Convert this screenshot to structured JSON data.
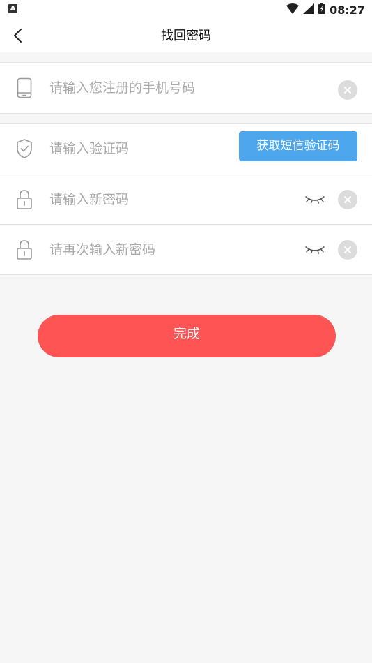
{
  "status_bar": {
    "time": "08:27",
    "left_icon": "A",
    "icons": [
      "wifi-icon",
      "signal-icon",
      "battery-icon"
    ]
  },
  "header": {
    "title": "找回密码",
    "back_icon": "chevron-left-icon"
  },
  "form": {
    "phone": {
      "placeholder": "请输入您注册的手机号码",
      "icon": "phone-icon"
    },
    "code": {
      "placeholder": "请输入验证码",
      "icon": "shield-check-icon",
      "button_label": "获取短信验证码"
    },
    "new_password": {
      "placeholder": "请输入新密码",
      "icon": "lock-icon"
    },
    "confirm_password": {
      "placeholder": "请再次输入新密码",
      "icon": "lock-icon"
    }
  },
  "submit_label": "完成",
  "colors": {
    "accent_red": "#fe5454",
    "sms_blue": "#4ea6ec",
    "background": "#f6f6f6",
    "placeholder": "#aaaaaa"
  }
}
